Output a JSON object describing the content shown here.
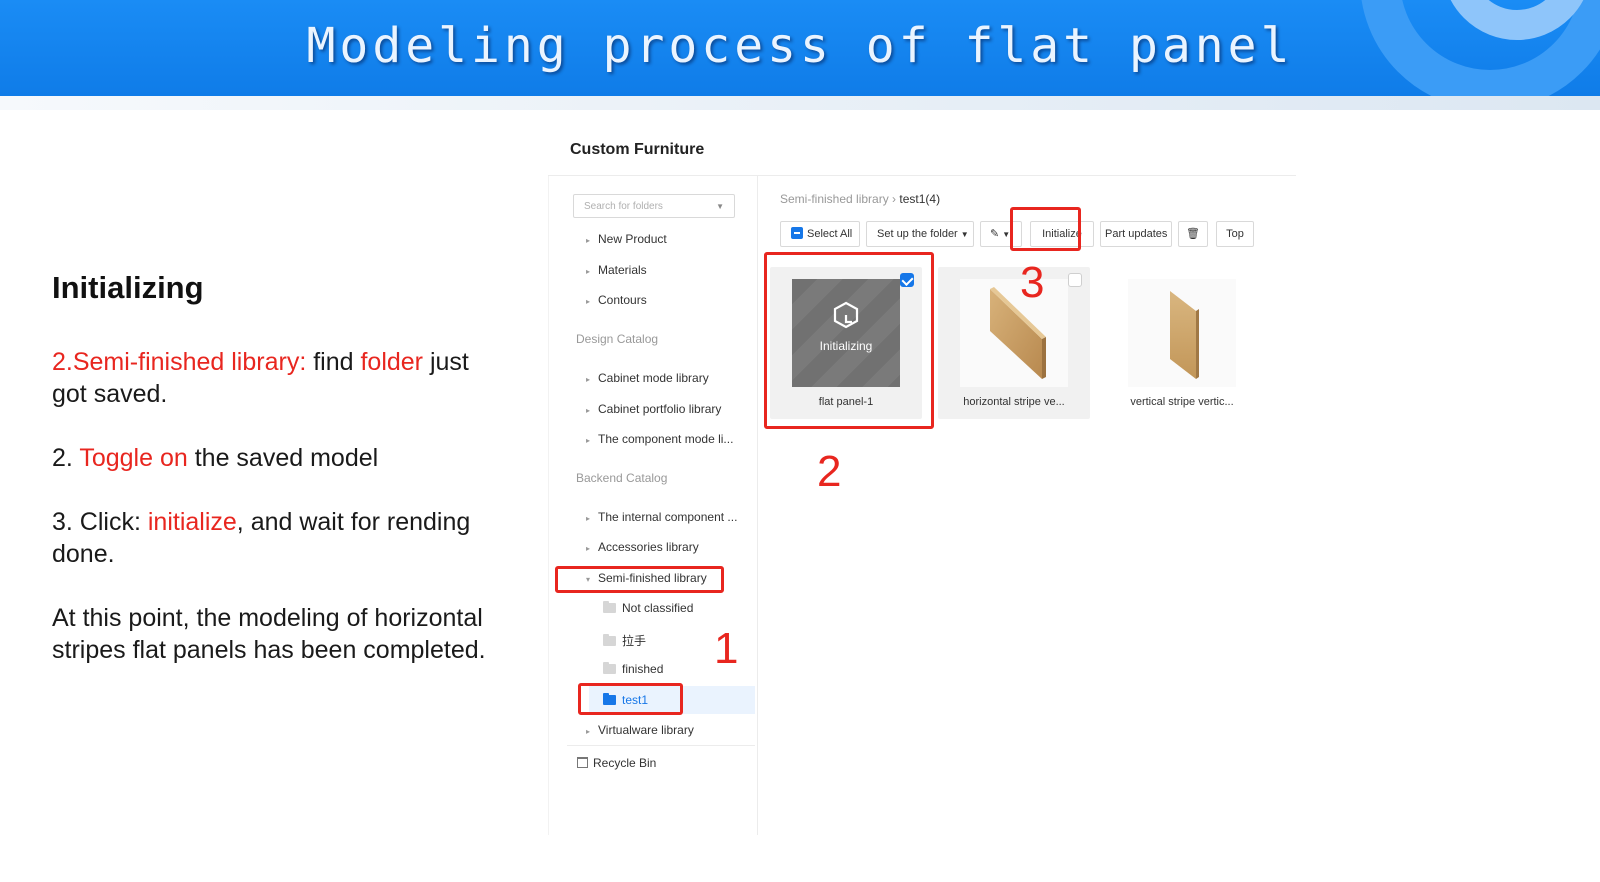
{
  "banner": {
    "title": "Modeling process of flat panel"
  },
  "left": {
    "heading": "Initializing",
    "step1": {
      "a": "2.Semi-finished library:",
      "b": " find ",
      "c": "folder",
      "d": " just got saved."
    },
    "step2": {
      "a": "2. ",
      "b": "Toggle on",
      "c": " the saved model"
    },
    "step3": {
      "a": "3. Click: ",
      "b": "initialize",
      "c": ", and wait for rending done."
    },
    "conclusion": "At this point, the modeling of horizontal stripes flat panels has been completed."
  },
  "app": {
    "title": "Custom Furniture",
    "search_placeholder": "Search for folders",
    "tree": {
      "new_product": "New Product",
      "materials": "Materials",
      "contours": "Contours",
      "design_catalog": "Design Catalog",
      "cabinet_mode": "Cabinet mode library",
      "cabinet_portfolio": "Cabinet portfolio library",
      "component_mode": "The component mode li...",
      "backend_catalog": "Backend Catalog",
      "internal_component": "The internal component ...",
      "accessories": "Accessories library",
      "semi_finished": "Semi-finished library",
      "not_classified": "Not classified",
      "lashou": "拉手",
      "finished": "finished",
      "test1": "test1",
      "virtualware": "Virtualware library",
      "recycle_bin": "Recycle Bin"
    },
    "breadcrumb": {
      "root": "Semi-finished library",
      "current": "test1(4)"
    },
    "toolbar": {
      "select_all": "Select All",
      "setup_folder": "Set up the folder",
      "initialize": "Initialize",
      "part_updates": "Part updates",
      "top": "Top"
    },
    "cards": [
      {
        "name": "flat panel-1",
        "status": "Initializing",
        "checked": true
      },
      {
        "name": "horizontal stripe ve...",
        "checked": false
      },
      {
        "name": "vertical stripe vertic...",
        "checked": false
      }
    ]
  },
  "annotations": {
    "n1": "1",
    "n2": "2",
    "n3": "3"
  },
  "colors": {
    "accent_red": "#e8261f",
    "primary_blue": "#1677e8",
    "banner_blue": "#1a8cf5"
  }
}
